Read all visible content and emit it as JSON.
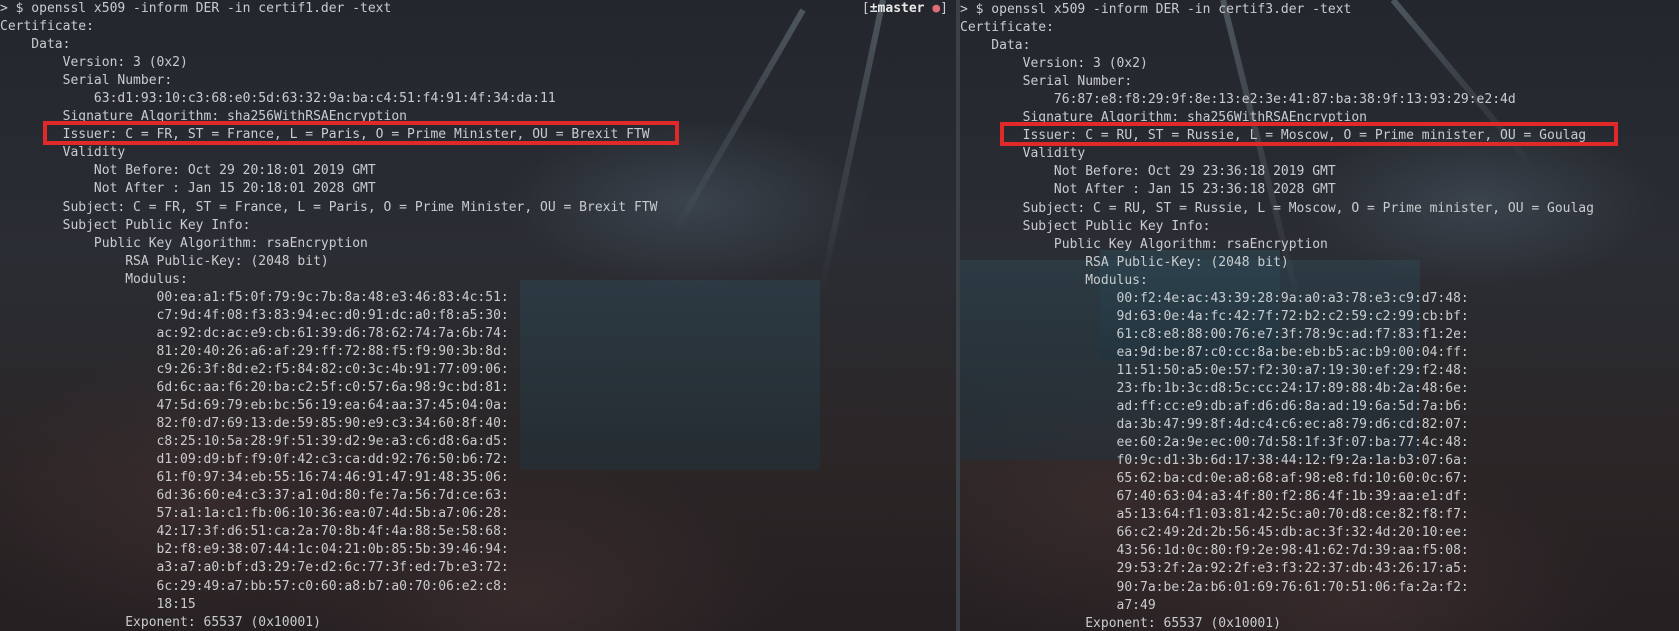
{
  "panes": {
    "left": {
      "git_status": {
        "bracket_open": "[",
        "branch": "±master",
        "dot": " ●",
        "bracket_close": "]"
      },
      "lines": [
        "> $ openssl x509 -inform DER -in certif1.der -text",
        "Certificate:",
        "    Data:",
        "        Version: 3 (0x2)",
        "        Serial Number:",
        "            63:d1:93:10:c3:68:e0:5d:63:32:9a:ba:c4:51:f4:91:4f:34:da:11",
        "        Signature Algorithm: sha256WithRSAEncryption",
        "        Issuer: C = FR, ST = France, L = Paris, O = Prime Minister, OU = Brexit FTW",
        "        Validity",
        "            Not Before: Oct 29 20:18:01 2019 GMT",
        "            Not After : Jan 15 20:18:01 2028 GMT",
        "        Subject: C = FR, ST = France, L = Paris, O = Prime Minister, OU = Brexit FTW",
        "        Subject Public Key Info:",
        "            Public Key Algorithm: rsaEncryption",
        "                RSA Public-Key: (2048 bit)",
        "                Modulus:",
        "                    00:ea:a1:f5:0f:79:9c:7b:8a:48:e3:46:83:4c:51:",
        "                    c7:9d:4f:08:f3:83:94:ec:d0:91:dc:a0:f8:a5:30:",
        "                    ac:92:dc:ac:e9:cb:61:39:d6:78:62:74:7a:6b:74:",
        "                    81:20:40:26:a6:af:29:ff:72:88:f5:f9:90:3b:8d:",
        "                    c9:26:3f:8d:e2:f5:84:82:c0:3c:4b:91:77:09:06:",
        "                    6d:6c:aa:f6:20:ba:c2:5f:c0:57:6a:98:9c:bd:81:",
        "                    47:5d:69:79:eb:bc:56:19:ea:64:aa:37:45:04:0a:",
        "                    82:f0:d7:69:13:de:59:85:90:e9:c3:34:60:8f:40:",
        "                    c8:25:10:5a:28:9f:51:39:d2:9e:a3:c6:d8:6a:d5:",
        "                    d1:09:d9:bf:f9:0f:42:c3:ca:dd:92:76:50:b6:72:",
        "                    61:f0:97:34:eb:55:16:74:46:91:47:91:48:35:06:",
        "                    6d:36:60:e4:c3:37:a1:0d:80:fe:7a:56:7d:ce:63:",
        "                    57:a1:1a:c1:fb:06:10:36:ea:07:4d:5b:a7:06:28:",
        "                    42:17:3f:d6:51:ca:2a:70:8b:4f:4a:88:5e:58:68:",
        "                    b2:f8:e9:38:07:44:1c:04:21:0b:85:5b:39:46:94:",
        "                    a3:a7:a0:bf:d3:29:7e:d2:6c:77:3f:ed:7b:e3:72:",
        "                    6c:29:49:a7:bb:57:c0:60:a8:b7:a0:70:06:e2:c8:",
        "                    18:15",
        "                Exponent: 65537 (0x10001)"
      ]
    },
    "right": {
      "lines": [
        "> $ openssl x509 -inform DER -in certif3.der -text",
        "Certificate:",
        "    Data:",
        "        Version: 3 (0x2)",
        "        Serial Number:",
        "            76:87:e8:f8:29:9f:8e:13:e2:3e:41:87:ba:38:9f:13:93:29:e2:4d",
        "        Signature Algorithm: sha256WithRSAEncryption",
        "        Issuer: C = RU, ST = Russie, L = Moscow, O = Prime minister, OU = Goulag",
        "        Validity",
        "            Not Before: Oct 29 23:36:18 2019 GMT",
        "            Not After : Jan 15 23:36:18 2028 GMT",
        "        Subject: C = RU, ST = Russie, L = Moscow, O = Prime minister, OU = Goulag",
        "        Subject Public Key Info:",
        "            Public Key Algorithm: rsaEncryption",
        "                RSA Public-Key: (2048 bit)",
        "                Modulus:",
        "                    00:f2:4e:ac:43:39:28:9a:a0:a3:78:e3:c9:d7:48:",
        "                    9d:63:0e:4a:fc:42:7f:72:b2:c2:59:c2:99:cb:bf:",
        "                    61:c8:e8:88:00:76:e7:3f:78:9c:ad:f7:83:f1:2e:",
        "                    ea:9d:be:87:c0:cc:8a:be:eb:b5:ac:b9:00:04:ff:",
        "                    11:51:50:a5:0e:57:f2:30:a7:19:30:ef:29:f2:48:",
        "                    23:fb:1b:3c:d8:5c:cc:24:17:89:88:4b:2a:48:6e:",
        "                    ad:ff:cc:e9:db:af:d6:d6:8a:ad:19:6a:5d:7a:b6:",
        "                    da:3b:47:99:8f:4d:c4:c6:ec:a8:79:d6:cd:82:07:",
        "                    ee:60:2a:9e:ec:00:7d:58:1f:3f:07:ba:77:4c:48:",
        "                    f0:9c:d1:3b:6d:17:38:44:12:f9:2a:1a:b3:07:6a:",
        "                    65:62:ba:cd:0e:a8:68:af:98:e8:fd:10:60:0c:67:",
        "                    67:40:63:04:a3:4f:80:f2:86:4f:1b:39:aa:e1:df:",
        "                    a5:13:64:f1:03:81:42:5c:a0:70:d8:ce:82:f8:f7:",
        "                    66:c2:49:2d:2b:56:45:db:ac:3f:32:4d:20:10:ee:",
        "                    43:56:1d:0c:80:f9:2e:98:41:62:7d:39:aa:f5:08:",
        "                    29:53:2f:2a:92:2f:e3:f3:22:37:db:43:26:17:a5:",
        "                    90:7a:be:2a:b6:01:69:76:61:70:51:06:fa:2a:f2:",
        "                    a7:49",
        "                Exponent: 65537 (0x10001)"
      ]
    }
  }
}
